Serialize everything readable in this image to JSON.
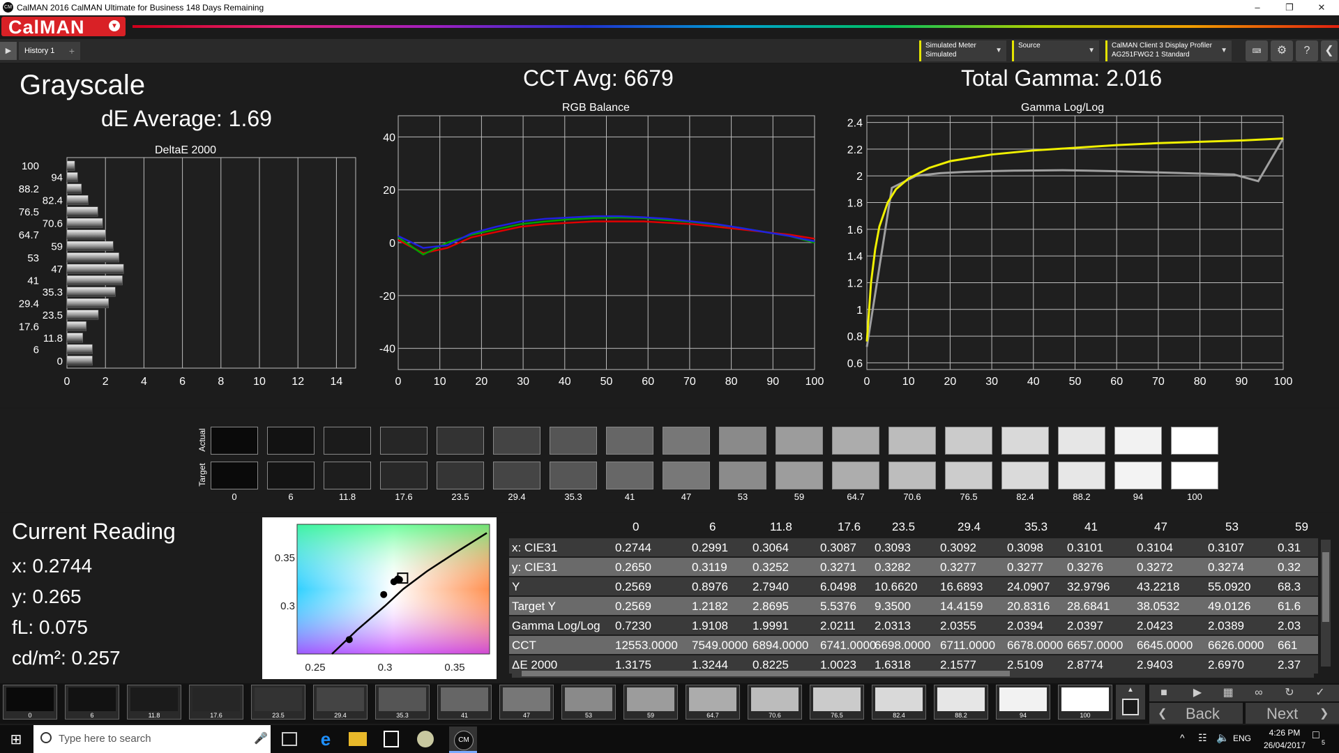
{
  "window": {
    "title": "CalMAN 2016 CalMAN Ultimate for Business 148 Days Remaining",
    "app_icon": "CM",
    "minimize_icon": "minimize-icon",
    "restore_icon": "restore-icon",
    "close_icon": "close-icon"
  },
  "header": {
    "logo": "CalMAN",
    "tab_label": "History 1",
    "dropdowns": [
      {
        "line1": "Simulated Meter",
        "line2": "Simulated"
      },
      {
        "line1": "Source",
        "line2": ""
      },
      {
        "line1": "CalMAN Client 3 Display Profiler",
        "line2": "AG251FWG2 1 Standard"
      }
    ],
    "accent_color": "#e5e500",
    "logo_color": "#d92126"
  },
  "summary": {
    "page_title": "Grayscale",
    "de_average": "dE Average: 1.69",
    "cct_avg": "CCT Avg: 6679",
    "total_gamma": "Total Gamma: 2.016"
  },
  "charts": {
    "deltae_title": "DeltaE 2000",
    "rgb_title": "RGB Balance",
    "gamma_title": "Gamma Log/Log"
  },
  "chart_data": [
    {
      "type": "bar",
      "title": "DeltaE 2000",
      "orientation": "horizontal",
      "categories": [
        "0",
        "6",
        "11.8",
        "17.6",
        "23.5",
        "29.4",
        "35.3",
        "41",
        "47",
        "53",
        "59",
        "64.7",
        "70.6",
        "76.5",
        "82.4",
        "88.2",
        "94",
        "100"
      ],
      "values": [
        1.32,
        1.32,
        0.82,
        1.0,
        1.63,
        2.16,
        2.51,
        2.88,
        2.94,
        2.7,
        2.4,
        2.0,
        1.85,
        1.6,
        1.1,
        0.75,
        0.55,
        0.4
      ],
      "xlim": [
        0,
        15
      ],
      "xticks": [
        "0",
        "2",
        "4",
        "6",
        "8",
        "10",
        "12",
        "14"
      ],
      "ylabels_left": [
        "100",
        "88.2",
        "76.5",
        "64.7",
        "53",
        "41",
        "29.4",
        "17.6",
        "6"
      ],
      "ylabels_right": [
        "94",
        "82.4",
        "70.6",
        "59",
        "47",
        "35.3",
        "23.5",
        "11.8",
        "0"
      ]
    },
    {
      "type": "line",
      "title": "RGB Balance",
      "x": [
        0,
        6,
        11.8,
        17.6,
        23.5,
        29.4,
        35.3,
        41,
        47,
        53,
        59,
        64.7,
        70.6,
        76.5,
        82.4,
        88.2,
        94,
        100
      ],
      "series": [
        {
          "color": "#e00000",
          "values": [
            1,
            -4,
            -2,
            2,
            4,
            6,
            7,
            7.5,
            8,
            8,
            8,
            7.5,
            7,
            6,
            5,
            4,
            3,
            1.5
          ]
        },
        {
          "color": "#00a000",
          "values": [
            2,
            -4.5,
            0,
            3,
            5,
            7,
            8,
            8.8,
            9.3,
            9.5,
            9.3,
            8.5,
            7.8,
            6.8,
            5.5,
            4,
            2.5,
            0
          ]
        },
        {
          "color": "#2020e0",
          "values": [
            2.5,
            -2,
            -1,
            3.5,
            6,
            8,
            9,
            9.5,
            10,
            10,
            9.6,
            9,
            8,
            7,
            5.5,
            4,
            2.5,
            0.5
          ]
        }
      ],
      "xlim": [
        0,
        100
      ],
      "ylim": [
        -48,
        48
      ],
      "xticks": [
        "0",
        "10",
        "20",
        "30",
        "40",
        "50",
        "60",
        "70",
        "80",
        "90",
        "100"
      ],
      "yticks": [
        "40",
        "20",
        "0",
        "-20",
        "-40"
      ]
    },
    {
      "type": "line",
      "title": "Gamma Log/Log",
      "x_yellow": [
        0,
        1,
        2,
        3,
        5,
        7,
        10,
        15,
        20,
        30,
        40,
        50,
        60,
        70,
        80,
        90,
        100
      ],
      "yellow": [
        0.76,
        1.2,
        1.45,
        1.62,
        1.8,
        1.9,
        1.98,
        2.06,
        2.11,
        2.16,
        2.19,
        2.21,
        2.23,
        2.245,
        2.255,
        2.265,
        2.28
      ],
      "x_gray": [
        0,
        6,
        11.8,
        17.6,
        23.5,
        29.4,
        35.3,
        41,
        47,
        53,
        59,
        64.7,
        70.6,
        76.5,
        82.4,
        88.2,
        94,
        100
      ],
      "gray": [
        0.72,
        1.91,
        2.0,
        2.02,
        2.03,
        2.035,
        2.039,
        2.04,
        2.042,
        2.039,
        2.035,
        2.03,
        2.025,
        2.02,
        2.015,
        2.01,
        1.96,
        2.28
      ],
      "series_colors": {
        "target": "#f0f000",
        "measured": "#a0a0a0"
      },
      "xlim": [
        0,
        100
      ],
      "ylim": [
        0.55,
        2.45
      ],
      "xticks": [
        "0",
        "10",
        "20",
        "30",
        "40",
        "50",
        "60",
        "70",
        "80",
        "90",
        "100"
      ],
      "yticks": [
        "2.4",
        "2.2",
        "2",
        "1.8",
        "1.6",
        "1.4",
        "1.2",
        "1",
        "0.8",
        "0.6"
      ]
    }
  ],
  "swatches": {
    "actual_label": "Actual",
    "target_label": "Target",
    "labels": [
      "0",
      "6",
      "11.8",
      "17.6",
      "23.5",
      "29.4",
      "35.3",
      "41",
      "47",
      "53",
      "59",
      "64.7",
      "70.6",
      "76.5",
      "82.4",
      "88.2",
      "94",
      "100"
    ],
    "actual_colors": [
      "#0a0a0a",
      "#121212",
      "#1b1b1b",
      "#262626",
      "#333333",
      "#444444",
      "#555555",
      "#666666",
      "#777777",
      "#8a8a8a",
      "#9c9c9c",
      "#acacac",
      "#bcbcbc",
      "#cbcbcb",
      "#d9d9d9",
      "#e6e6e6",
      "#f2f2f2",
      "#ffffff"
    ],
    "target_colors": [
      "#0a0a0a",
      "#141414",
      "#1d1d1d",
      "#282828",
      "#353535",
      "#454545",
      "#565656",
      "#676767",
      "#787878",
      "#8b8b8b",
      "#9d9d9d",
      "#adadad",
      "#bdbdbd",
      "#cccccc",
      "#dadada",
      "#e7e7e7",
      "#f3f3f3",
      "#ffffff"
    ]
  },
  "current_reading": {
    "title": "Current Reading",
    "x": "x: 0.2744",
    "y": "y: 0.265",
    "fl": "fL: 0.075",
    "cdm2": "cd/m²: 0.257"
  },
  "cie": {
    "xticks": [
      "0.25",
      "0.3",
      "0.35"
    ],
    "yticks": [
      "0.35",
      "0.3"
    ]
  },
  "table": {
    "columns": [
      "0",
      "6",
      "11.8",
      "17.6",
      "23.5",
      "29.4",
      "35.3",
      "41",
      "47",
      "53",
      "59"
    ],
    "rows": [
      {
        "label": "x: CIE31",
        "values": [
          "0.2744",
          "0.2991",
          "0.3064",
          "0.3087",
          "0.3093",
          "0.3092",
          "0.3098",
          "0.3101",
          "0.3104",
          "0.3107",
          "0.31"
        ]
      },
      {
        "label": "y: CIE31",
        "values": [
          "0.2650",
          "0.3119",
          "0.3252",
          "0.3271",
          "0.3282",
          "0.3277",
          "0.3277",
          "0.3276",
          "0.3272",
          "0.3274",
          "0.32"
        ]
      },
      {
        "label": "Y",
        "values": [
          "0.2569",
          "0.8976",
          "2.7940",
          "6.0498",
          "10.6620",
          "16.6893",
          "24.0907",
          "32.9796",
          "43.2218",
          "55.0920",
          "68.3"
        ]
      },
      {
        "label": "Target Y",
        "values": [
          "0.2569",
          "1.2182",
          "2.8695",
          "5.5376",
          "9.3500",
          "14.4159",
          "20.8316",
          "28.6841",
          "38.0532",
          "49.0126",
          "61.6"
        ]
      },
      {
        "label": "Gamma Log/Log",
        "values": [
          "0.7230",
          "1.9108",
          "1.9991",
          "2.0211",
          "2.0313",
          "2.0355",
          "2.0394",
          "2.0397",
          "2.0423",
          "2.0389",
          "2.03"
        ]
      },
      {
        "label": "CCT",
        "values": [
          "12553.0000",
          "7549.0000",
          "6894.0000",
          "6741.0000",
          "6698.0000",
          "6711.0000",
          "6678.0000",
          "6657.0000",
          "6645.0000",
          "6626.0000",
          "661"
        ]
      },
      {
        "label": "ΔE 2000",
        "values": [
          "1.3175",
          "1.3244",
          "0.8225",
          "1.0023",
          "1.6318",
          "2.1577",
          "2.5109",
          "2.8774",
          "2.9403",
          "2.6970",
          "2.37"
        ]
      }
    ]
  },
  "strip": {
    "labels": [
      "0",
      "6",
      "11.8",
      "17.6",
      "23.5",
      "29.4",
      "35.3",
      "41",
      "47",
      "53",
      "59",
      "64.7",
      "70.6",
      "76.5",
      "82.4",
      "88.2",
      "94",
      "100"
    ],
    "colors": [
      "#0a0a0a",
      "#121212",
      "#1b1b1b",
      "#262626",
      "#333333",
      "#444444",
      "#555555",
      "#666666",
      "#777777",
      "#8a8a8a",
      "#9c9c9c",
      "#acacac",
      "#bcbcbc",
      "#cbcbcb",
      "#d9d9d9",
      "#e6e6e6",
      "#f2f2f2",
      "#ffffff"
    ]
  },
  "nav": {
    "back": "Back",
    "next": "Next"
  },
  "taskbar": {
    "search_placeholder": "Type here to search",
    "lang": "ENG",
    "time": "4:26 PM",
    "date": "26/04/2017",
    "notif_count": "5",
    "app_cm": "CM"
  }
}
